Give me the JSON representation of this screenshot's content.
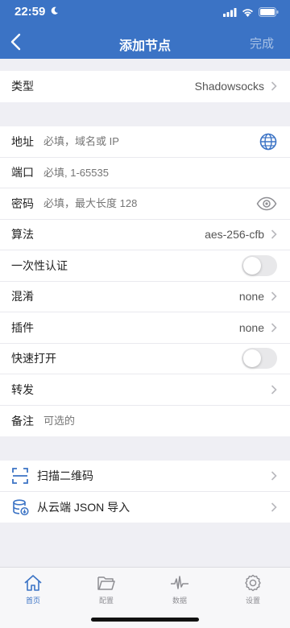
{
  "status_bar": {
    "time": "22:59"
  },
  "navbar": {
    "title": "添加节点",
    "done_label": "完成"
  },
  "type_row": {
    "label": "类型",
    "value": "Shadowsocks"
  },
  "form": {
    "address": {
      "label": "地址",
      "placeholder": "必填，域名或 IP"
    },
    "port": {
      "label": "端口",
      "placeholder": "必填, 1-65535"
    },
    "password": {
      "label": "密码",
      "placeholder": "必填，最大长度 128"
    },
    "cipher": {
      "label": "算法",
      "value": "aes-256-cfb"
    },
    "ota": {
      "label": "一次性认证",
      "on": false
    },
    "obfs": {
      "label": "混淆",
      "value": "none"
    },
    "plugin": {
      "label": "插件",
      "value": "none"
    },
    "fast_open": {
      "label": "快速打开",
      "on": false
    },
    "forward": {
      "label": "转发"
    },
    "remark": {
      "label": "备注",
      "placeholder": "可选的"
    }
  },
  "actions": {
    "scan": {
      "label": "扫描二维码"
    },
    "import": {
      "label": "从云端 JSON 导入"
    }
  },
  "tabbar": {
    "items": [
      {
        "label": "首页",
        "icon": "home-icon",
        "active": true
      },
      {
        "label": "配置",
        "icon": "folder-icon",
        "active": false
      },
      {
        "label": "数据",
        "icon": "pulse-icon",
        "active": false
      },
      {
        "label": "设置",
        "icon": "gear-icon",
        "active": false
      }
    ]
  },
  "colors": {
    "accent": "#3b73c5",
    "background": "#efeff4",
    "toggle_off": "#e8e8ea"
  }
}
